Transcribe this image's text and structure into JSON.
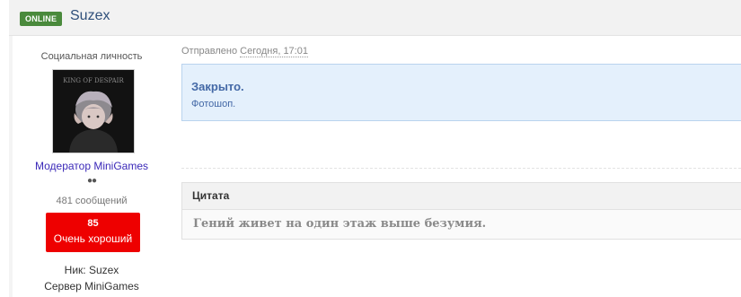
{
  "header": {
    "status_badge": "ONLINE",
    "username": "Suzex"
  },
  "user": {
    "title": "Социальная личность",
    "avatar_text": "KING OF DESPAIR",
    "role": "Модератор MiniGames",
    "dots": "●●",
    "messages": "481 сообщений",
    "reputation": {
      "value": "85",
      "label": "Очень хороший"
    },
    "nick": "Ник: Suzex",
    "server": "Сервер MiniGames"
  },
  "post": {
    "sent_label": "Отправлено",
    "date": "Сегодня, 17:01",
    "notice": {
      "title": "Закрыто.",
      "text": "Фотошоп."
    },
    "quote": {
      "header": "Цитата",
      "text": "Гений живет на один этаж выше безумия."
    }
  },
  "colors": {
    "online": "#4a8a3c",
    "username": "#2f4f7a",
    "role": "#3a28b8",
    "reputation": "#ee0000",
    "notice_bg": "#e4f0fc",
    "notice_text": "#4368a6"
  }
}
